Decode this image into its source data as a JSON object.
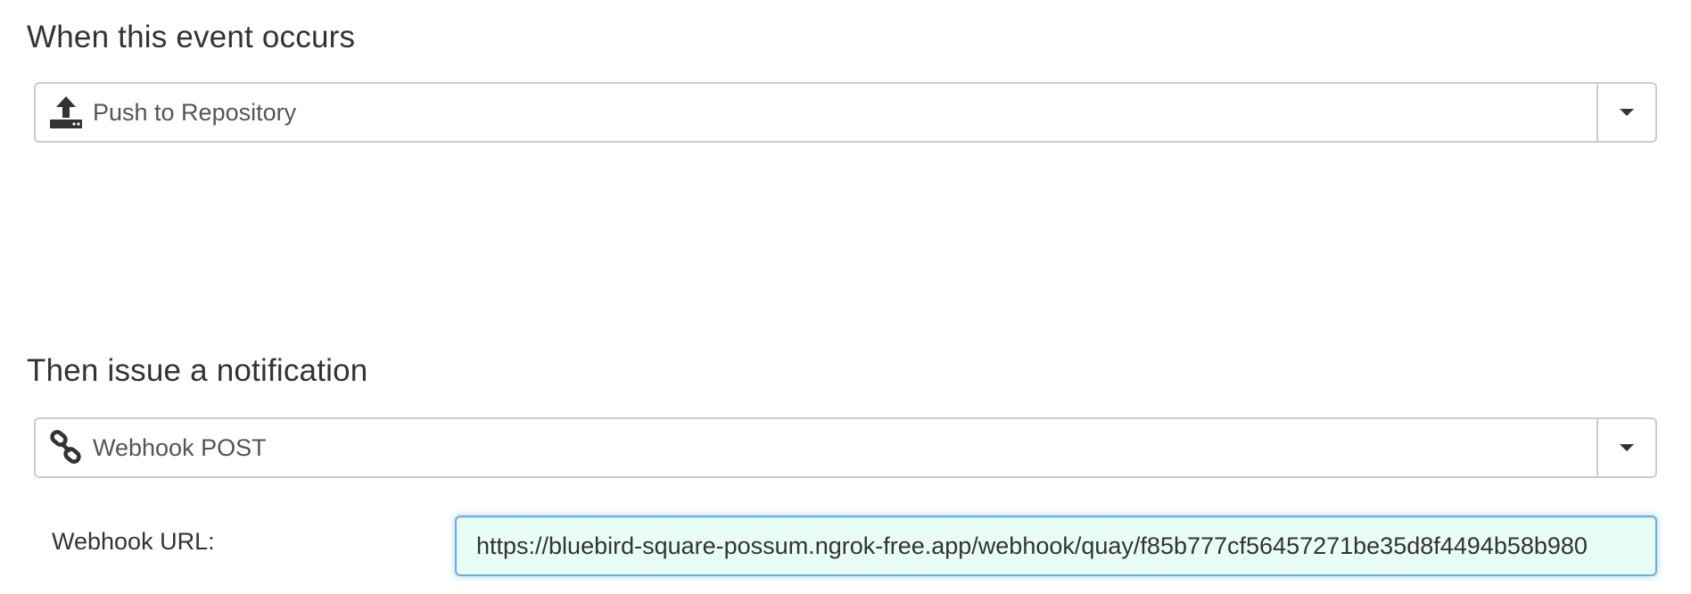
{
  "event_section": {
    "title": "When this event occurs",
    "selected_event": "Push to Repository",
    "icon": "upload-icon"
  },
  "notification_section": {
    "title": "Then issue a notification",
    "selected_method": "Webhook POST",
    "icon": "link-icon",
    "webhook_url_label": "Webhook URL:",
    "webhook_url_value": "https://bluebird-square-possum.ngrok-free.app/webhook/quay/f85b777cf56457271be35d8f4494b58b980"
  }
}
